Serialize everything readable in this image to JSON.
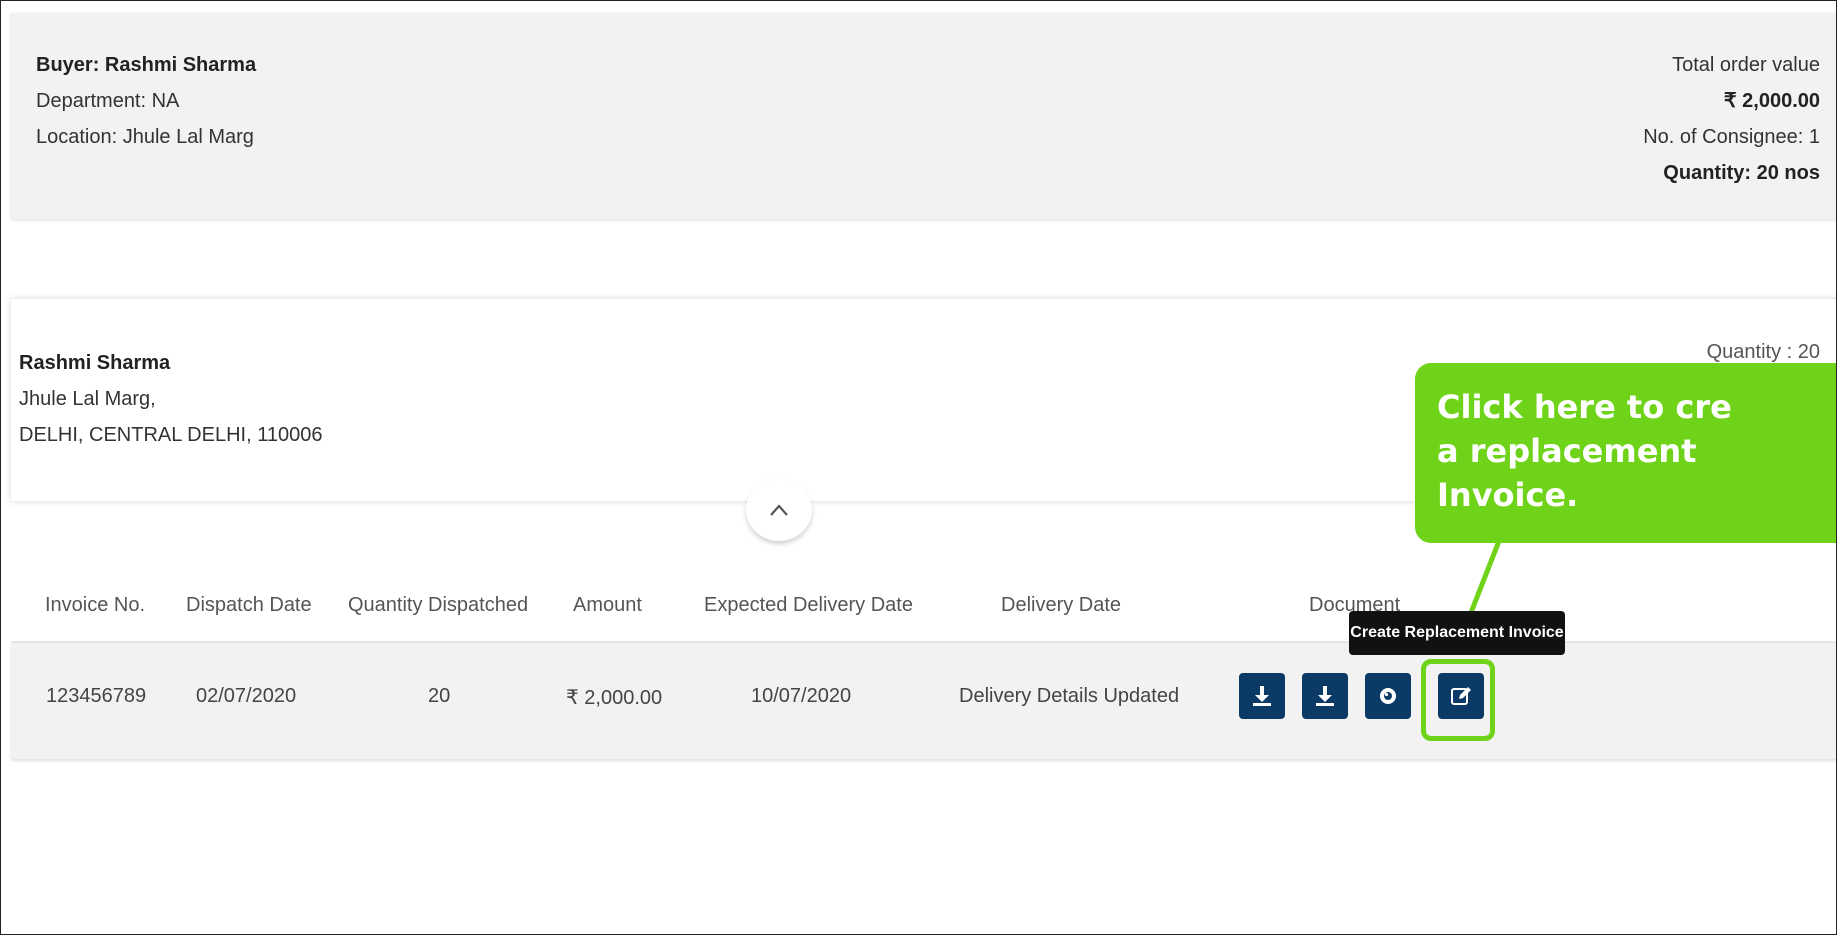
{
  "summary": {
    "buyer": "Buyer: Rashmi Sharma",
    "department": "Department: NA",
    "location": "Location: Jhule Lal Marg",
    "total_label": "Total order value",
    "total_value": "₹ 2,000.00",
    "consignees": "No. of Consignee: 1",
    "quantity": "Quantity: 20 nos"
  },
  "consignee": {
    "name": "Rashmi Sharma",
    "address1": "Jhule Lal Marg,",
    "address2": "DELHI, CENTRAL DELHI, 110006",
    "quantity": "Quantity : 20"
  },
  "table": {
    "headers": [
      "Invoice No.",
      "Dispatch Date",
      "Quantity Dispatched",
      "Amount",
      "Expected Delivery Date",
      "Delivery Date",
      "Document"
    ],
    "row": [
      "123456789",
      "02/07/2020",
      "20",
      "₹ 2,000.00",
      "10/07/2020",
      "Delivery Details Updated"
    ]
  },
  "icons": {
    "download_invoice": "download-icon",
    "download_document": "download-icon",
    "view": "eye-icon",
    "edit": "edit-icon",
    "collapse": "chevron-up-icon"
  },
  "tooltip": "Create Replacement Invoice",
  "callout": {
    "line1": "Click here to cre",
    "line2": "a replacement",
    "line3": "Invoice."
  },
  "colors": {
    "accent_green": "#6fd319",
    "button_navy": "#0b3a66"
  }
}
